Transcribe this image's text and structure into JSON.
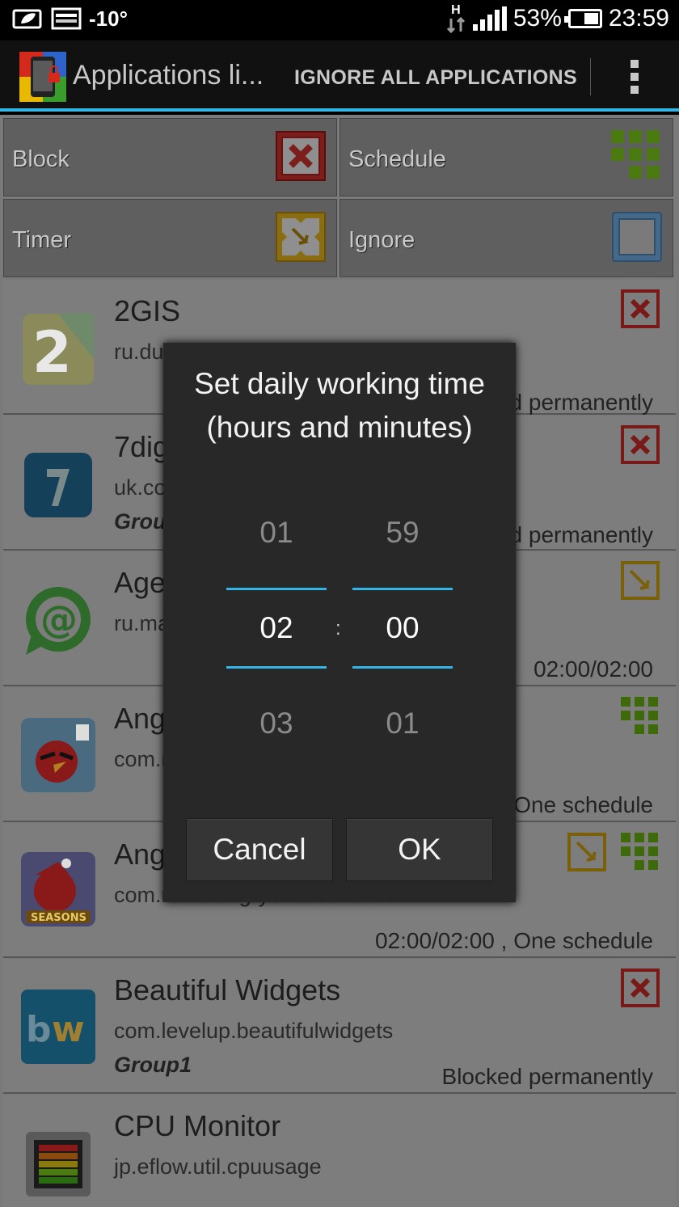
{
  "status_bar": {
    "temperature": "-10°",
    "network_type": "H",
    "battery": "53%",
    "time": "23:59",
    "icons": [
      "leaf-notification-icon",
      "image-notification-icon",
      "network-type-icon",
      "signal-icon",
      "battery-icon"
    ],
    "battery_level": 0.53
  },
  "action_bar": {
    "title": "Applications li...",
    "action": "IGNORE ALL APPLICATIONS",
    "overflow_icon": "overflow-menu-icon"
  },
  "filters": [
    {
      "label": "Block",
      "icon": "block-icon"
    },
    {
      "label": "Schedule",
      "icon": "schedule-icon"
    },
    {
      "label": "Timer",
      "icon": "timer-icon"
    },
    {
      "label": "Ignore",
      "icon": "ignore-icon"
    }
  ],
  "apps": [
    {
      "name": "2GIS",
      "package": "ru.dublgis.dgismobile",
      "group": "",
      "status": "Blocked permanently",
      "badges": [
        "block"
      ]
    },
    {
      "name": "7digital",
      "package": "uk.co.sevendigital.android",
      "group": "Group1",
      "status": "Blocked permanently",
      "badges": [
        "block"
      ]
    },
    {
      "name": "Agent",
      "package": "ru.mail",
      "group": "",
      "status": "02:00/02:00",
      "badges": [
        "timer"
      ]
    },
    {
      "name": "Angry Birds",
      "package": "com.rovio.angrybirds",
      "group": "",
      "status": "One schedule",
      "badges": [
        "schedule"
      ]
    },
    {
      "name": "Angry Birds Seasons",
      "package": "com.rovio.angrybirdsseasons",
      "group": "",
      "status": "02:00/02:00 , One schedule",
      "badges": [
        "timer",
        "schedule"
      ]
    },
    {
      "name": "Beautiful Widgets",
      "package": "com.levelup.beautifulwidgets",
      "group": "Group1",
      "status": "Blocked permanently",
      "badges": [
        "block"
      ]
    },
    {
      "name": "CPU Monitor",
      "package": "jp.eflow.util.cpuusage",
      "group": "",
      "status": "",
      "badges": []
    }
  ],
  "colors": {
    "accent": "#33b5e5",
    "block_red": "#b3201e",
    "timer_yellow": "#c89a00",
    "schedule_green": "#5a9a10",
    "ignore_blue": "#5b93c0"
  },
  "dialog": {
    "title": "Set daily working time (hours and minutes)",
    "hours": {
      "prev": "01",
      "current": "02",
      "next": "03"
    },
    "separator": ":",
    "minutes": {
      "prev": "59",
      "current": "00",
      "next": "01"
    },
    "cancel_label": "Cancel",
    "ok_label": "OK"
  }
}
